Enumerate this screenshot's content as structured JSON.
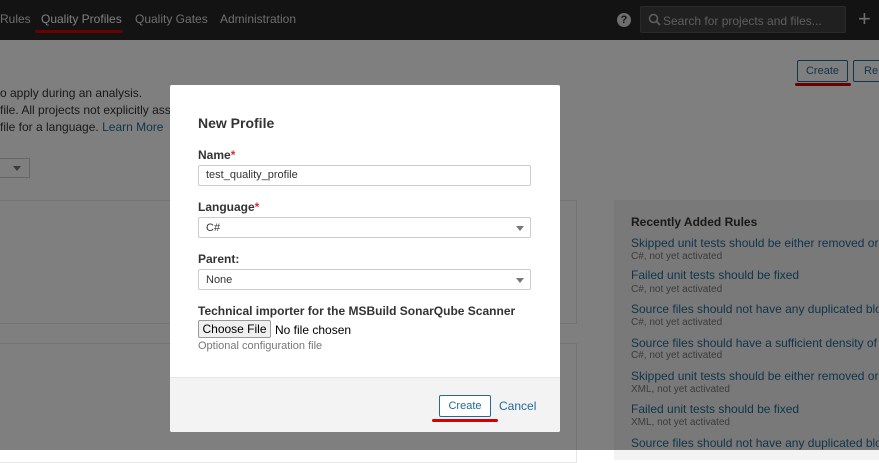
{
  "nav": {
    "items": [
      {
        "label": "Rules"
      },
      {
        "label": "Quality Profiles"
      },
      {
        "label": "Quality Gates"
      },
      {
        "label": "Administration"
      }
    ],
    "search_placeholder": "Search for projects and files...",
    "help_glyph": "?",
    "plus_glyph": "+"
  },
  "background": {
    "description_lines": [
      "o apply during an analysis.",
      "file. All projects not explicitly assig",
      "file for a language."
    ],
    "learn_more": "Learn More",
    "create_label": "Create",
    "restore_label": "Re",
    "recent_rules": {
      "heading": "Recently Added Rules",
      "items": [
        {
          "title": "Skipped unit tests should be either removed or fix",
          "meta": "C#, not yet activated"
        },
        {
          "title": "Failed unit tests should be fixed",
          "meta": "C#, not yet activated"
        },
        {
          "title": "Source files should not have any duplicated blocks",
          "meta": "C#, not yet activated"
        },
        {
          "title": "Source files should have a sufficient density of com",
          "meta": "C#, not yet activated"
        },
        {
          "title": "Skipped unit tests should be either removed or fix",
          "meta": "XML, not yet activated"
        },
        {
          "title": "Failed unit tests should be fixed",
          "meta": "XML, not yet activated"
        },
        {
          "title": "Source files should not have any duplicated blocks",
          "meta": ""
        }
      ]
    }
  },
  "modal": {
    "title": "New Profile",
    "name_label": "Name",
    "name_value": "test_quality_profile",
    "language_label": "Language",
    "language_value": "C#",
    "parent_label": "Parent:",
    "parent_value": "None",
    "importer_label": "Technical importer for the MSBuild SonarQube Scanner",
    "choose_file_label": "Choose File",
    "file_status": "No file chosen",
    "optional_hint": "Optional configuration file",
    "create_label": "Create",
    "cancel_label": "Cancel",
    "required_mark": "*"
  },
  "colors": {
    "topbar": "#262626",
    "link": "#236a97",
    "highlight": "#d50000",
    "required": "#d02f3a"
  }
}
